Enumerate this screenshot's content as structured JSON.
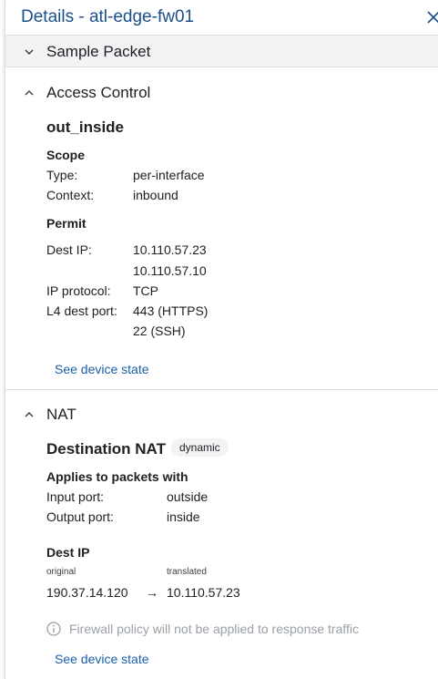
{
  "header": {
    "title": "Details - atl-edge-fw01"
  },
  "sample_packet": {
    "label": "Sample Packet"
  },
  "access_control": {
    "section_label": "Access Control",
    "rule_name": "out_inside",
    "scope": {
      "heading": "Scope",
      "type_label": "Type:",
      "type_value": "per-interface",
      "context_label": "Context:",
      "context_value": "inbound"
    },
    "permit": {
      "heading": "Permit",
      "dest_ip_label": "Dest IP:",
      "dest_ips": [
        "10.110.57.23",
        "10.110.57.10"
      ],
      "ip_protocol_label": "IP protocol:",
      "ip_protocol_value": "TCP",
      "l4_port_label": "L4 dest port:",
      "l4_ports": [
        "443 (HTTPS)",
        "22 (SSH)"
      ]
    },
    "link": "See device state"
  },
  "nat": {
    "section_label": "NAT",
    "type_title": "Destination NAT",
    "badge": "dynamic",
    "applies_heading": "Applies to packets with",
    "input_port_label": "Input port:",
    "input_port_value": "outside",
    "output_port_label": "Output port:",
    "output_port_value": "inside",
    "dest_ip_heading": "Dest IP",
    "original_label": "original",
    "translated_label": "translated",
    "original_value": "190.37.14.120",
    "arrow": "→",
    "translated_value": "10.110.57.23",
    "note": "Firewall policy will not be applied to response traffic",
    "link": "See device state"
  },
  "icons": {
    "close": "close-icon",
    "chevron_down": "chevron-down-icon",
    "chevron_up": "chevron-up-icon",
    "info": "info-icon"
  },
  "colors": {
    "title": "#1a4f8b",
    "link": "#1a5fa8",
    "subbar_bg": "#f1f3f4",
    "note": "#9aa0a6"
  }
}
